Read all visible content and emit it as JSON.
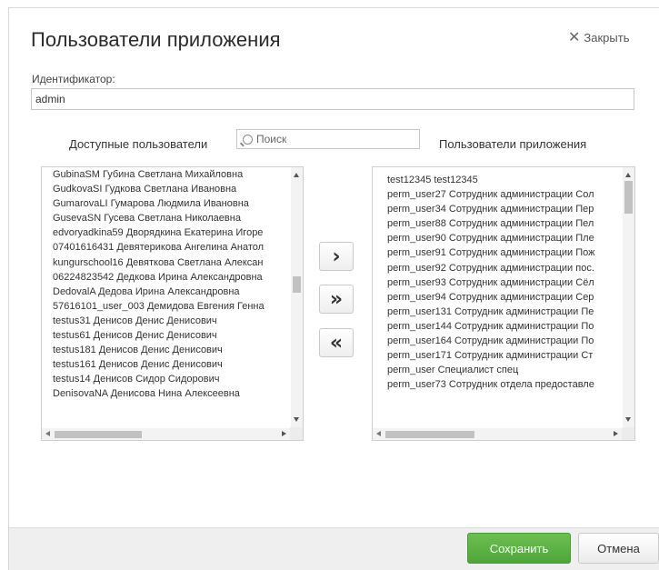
{
  "dialog": {
    "title": "Пользователи приложения",
    "close_label": "Закрыть"
  },
  "identifier": {
    "label": "Идентификатор:",
    "value": "admin"
  },
  "available": {
    "heading": "Доступные пользователи",
    "items": [
      "GubinaSM Губина Светлана Михайловна",
      "GudkovaSI Гудкова Светлана Ивановна",
      "GumarovaLI Гумарова Людмила Ивановна",
      "GusevaSN Гусева Светлана Николаевна",
      "edvoryadkina59 Дворядкина Екатерина Игоре",
      "07401616431 Девятерикова Ангелина Анатол",
      "kungurschool16 Девяткова Светлана Алексан",
      "06224823542 Дедкова Ирина Александровна",
      "DedovalA Дедова Ирина Александровна",
      "57616101_user_003 Демидова Евгения Генна",
      "testus31 Денисов Денис Денисович",
      "testus61 Денисов Денис Денисович",
      "testus181 Денисов Денис Денисович",
      "testus161 Денисов Денис Денисович",
      "testus14 Денисов Сидор Сидорович",
      "DenisovaNA Денисова Нина Алексеевна"
    ]
  },
  "search": {
    "placeholder": "Поиск"
  },
  "app_users": {
    "heading": "Пользователи приложения",
    "items": [
      "test12345 test12345",
      "perm_user27 Сотрудник администрации Сол",
      "perm_user34 Сотрудник администрации Пер",
      "perm_user88 Сотрудник администрации Пел",
      "perm_user90 Сотрудник администрации Пле",
      "perm_user91 Сотрудник администрации Пож",
      "perm_user92 Сотрудник администрации пос.",
      "perm_user93 Сотрудник администрации Сёл",
      "perm_user94 Сотрудник администрации Сер",
      "perm_user131 Сотрудник администрации Пе",
      "perm_user144 Сотрудник администрации По",
      "perm_user164 Сотрудник администрации По",
      "perm_user171 Сотрудник администрации Ст",
      "perm_user Специалист спец",
      "perm_user73 Сотрудник отдела предоставле"
    ]
  },
  "move_buttons": {
    "add_one": "›",
    "add_all": "»",
    "remove_all": "«"
  },
  "footer": {
    "save_label": "Сохранить",
    "cancel_label": "Отмена"
  }
}
